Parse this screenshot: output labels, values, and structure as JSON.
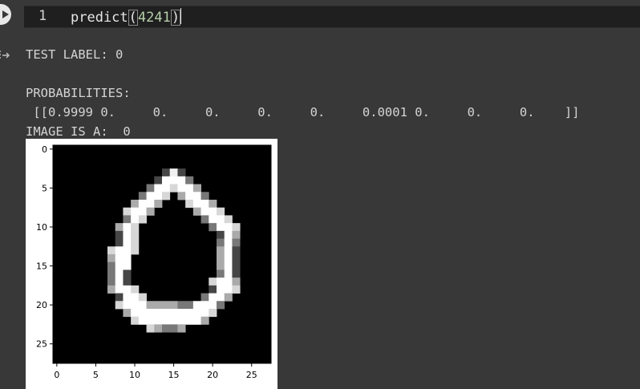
{
  "cell": {
    "line_number": "1",
    "code_function": "predict",
    "code_open": "(",
    "code_arg": "4241",
    "code_close": ")"
  },
  "output": {
    "lines": [
      "TEST LABEL: 0",
      "",
      "PROBABILITIES:",
      " [[0.9999 0.     0.     0.     0.     0.     0.0001 0.     0.     0.    ]]",
      "IMAGE IS A:  0"
    ]
  },
  "icons": {
    "run": "play-icon",
    "output": "output-redirect-icon"
  },
  "colors": {
    "background": "#383838",
    "editor": "#1f1f1f",
    "text": "#d4d4d4",
    "number": "#b5cea8"
  },
  "image_plot": {
    "type": "heatmap",
    "colormap": "gray",
    "xlim": [
      -0.5,
      27.5
    ],
    "ylim": [
      27.5,
      -0.5
    ],
    "x_ticks": [
      "0",
      "5",
      "10",
      "15",
      "20",
      "25"
    ],
    "y_ticks": [
      "0",
      "5",
      "10",
      "15",
      "20",
      "25"
    ],
    "digit_rows": {
      "3": "..............dEd...........",
      "4": ".............dWWWc..........",
      "5": "............cWWaWWb.........",
      "6": "...........cWWa.bWWc........",
      "7": "..........bWWb...aWWb.......",
      "8": ".........aWWb.....bWWa......",
      "9": ".........cWa.......cWWa.....",
      "10": "........bWa.........cWWa....",
      "11": "........dWa..........dWb....",
      "12": "........dWa..........cWc....",
      "13": ".......aWWa..........bWd....",
      "14": ".......bWW...........bWd....",
      "15": ".......cWW...........bWd....",
      "16": ".......cWd...........cWd....",
      "17": ".......cWd..........aWWb....",
      "18": ".......bWWa.........dWWa....",
      "19": "........dWWa.......cWWb.....",
      "20": "........aWWWbbbbccWWWc......",
      "21": ".........bWWWWWWWWWWa.......",
      "22": "..........aWWWWWWWWb........",
      "23": "............abccb...........",
      "24": "............................"
    }
  }
}
